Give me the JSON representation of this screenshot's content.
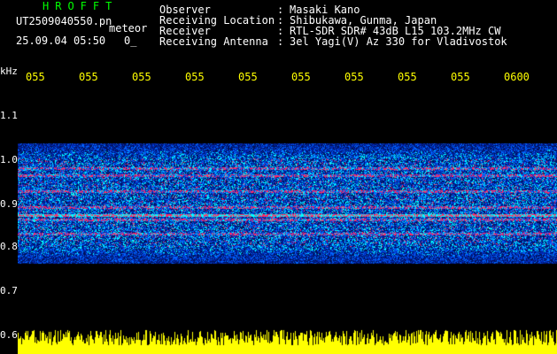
{
  "header": {
    "title": "HROFFT",
    "file_name": "UT2509040550.pn",
    "file_suffix": "meteor",
    "datetime": "25.09.04 05:50",
    "zero": "0_",
    "fields": [
      {
        "label": "Observer",
        "value": "Masaki Kano"
      },
      {
        "label": "Receiving Location",
        "value": "Shibukawa, Gunma, Japan"
      },
      {
        "label": "Receiver",
        "value": "RTL-SDR SDR# 43dB L15 103.2MHz CW"
      },
      {
        "label": "Receiving Antenna",
        "value": "3el Yagi(V) Az 330 for Vladivostok"
      }
    ]
  },
  "axes": {
    "unit": "kHz",
    "y_labels": [
      "1.1",
      "1.0",
      "0.9",
      "0.8",
      "0.7",
      "0.6"
    ],
    "time_labels": [
      "055",
      "055",
      "055",
      "055",
      "055",
      "055",
      "055",
      "055",
      "055",
      "0600"
    ]
  },
  "colors": {
    "title": "#00ff00",
    "time_labels": "#ffff00",
    "background": "#000000",
    "noise_low": "#001a66",
    "noise_mid": "#0066ff",
    "noise_high": "#00ffff",
    "band_peak": "#ff2a66",
    "signal_bars": "#ffff00"
  }
}
